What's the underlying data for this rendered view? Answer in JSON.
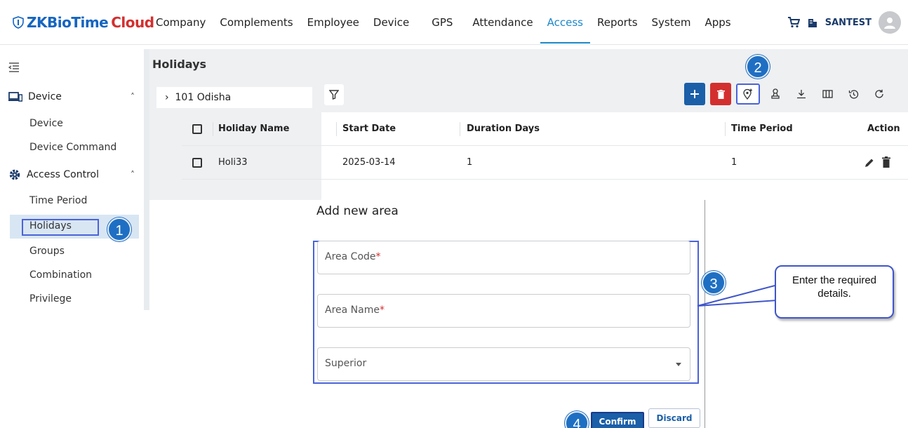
{
  "app": {
    "logo_part1": "ZKBioTime",
    "logo_part2": "Cloud"
  },
  "nav": [
    {
      "label": "Company"
    },
    {
      "label": "Complements"
    },
    {
      "label": "Employee"
    },
    {
      "label": "Device"
    },
    {
      "label": "GPS"
    },
    {
      "label": "Attendance"
    },
    {
      "label": "Access",
      "active": true
    },
    {
      "label": "Reports"
    },
    {
      "label": "System"
    },
    {
      "label": "Apps"
    }
  ],
  "user": {
    "company": "SANTEST"
  },
  "sidebar": {
    "sections": [
      {
        "label": "Device",
        "items": [
          "Device",
          "Device Command"
        ]
      },
      {
        "label": "Access Control",
        "items": [
          "Time Period",
          "Holidays",
          "Groups",
          "Combination",
          "Privilege"
        ]
      }
    ],
    "selected": "Holidays"
  },
  "page": {
    "title": "Holidays"
  },
  "tree": {
    "node": "101 Odisha"
  },
  "table": {
    "headers": [
      "Holiday Name",
      "Start Date",
      "Duration Days",
      "Time Period",
      "Action"
    ],
    "rows": [
      {
        "name": "Holi33",
        "start": "2025-03-14",
        "duration": "1",
        "period": "1"
      }
    ]
  },
  "dialog": {
    "title": "Add new area",
    "fields": [
      {
        "label": "Area Code",
        "required": "*"
      },
      {
        "label": "Area Name",
        "required": "*"
      },
      {
        "label": "Superior",
        "required": ""
      }
    ],
    "confirm": "Confirm",
    "discard": "Discard"
  },
  "annotations": {
    "step1": "1",
    "step2": "2",
    "step3": "3",
    "step4": "4",
    "callout": "Enter the required details."
  },
  "colors": {
    "accent": "#1e88c8",
    "primary": "#1a5fa8",
    "danger": "#d32f2f",
    "annotation": "#4a63d9"
  }
}
